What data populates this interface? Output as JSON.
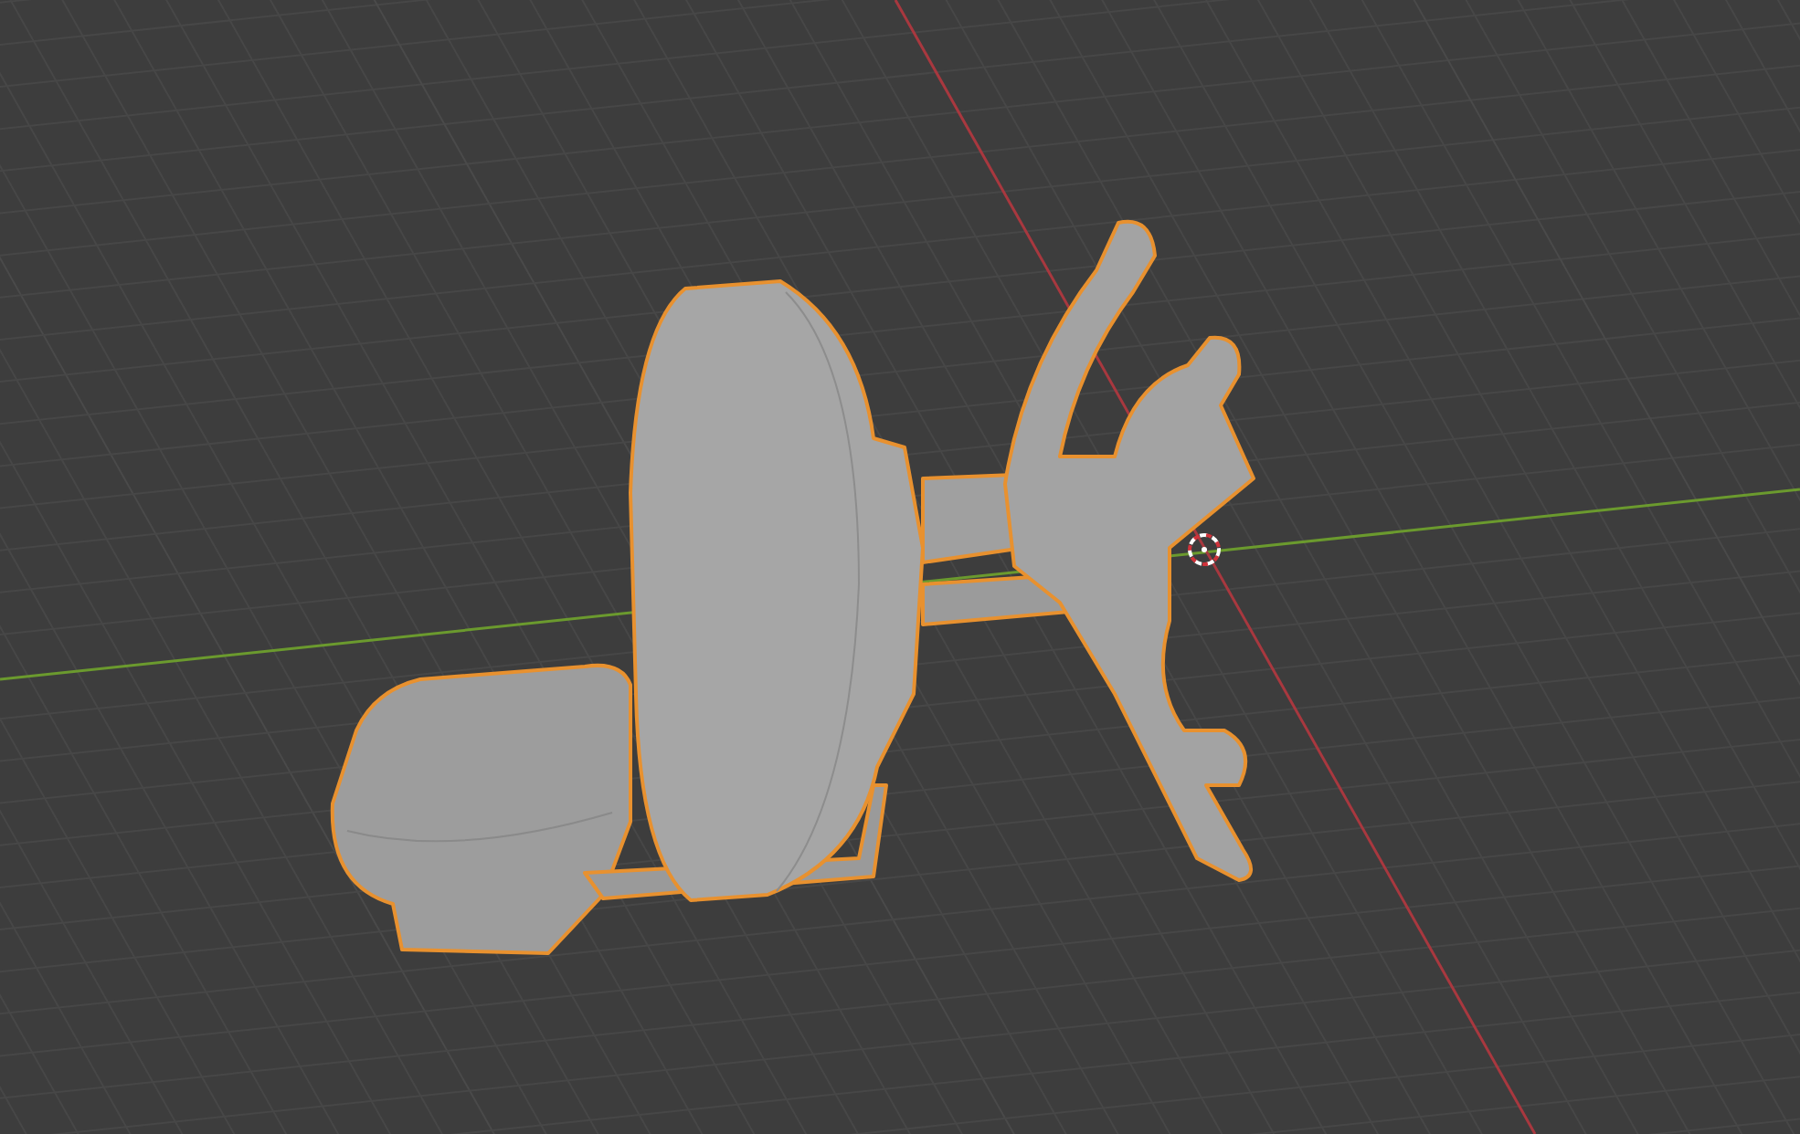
{
  "viewport": {
    "object": {
      "selected": true
    },
    "cursor_3d": {
      "visible": true
    }
  }
}
